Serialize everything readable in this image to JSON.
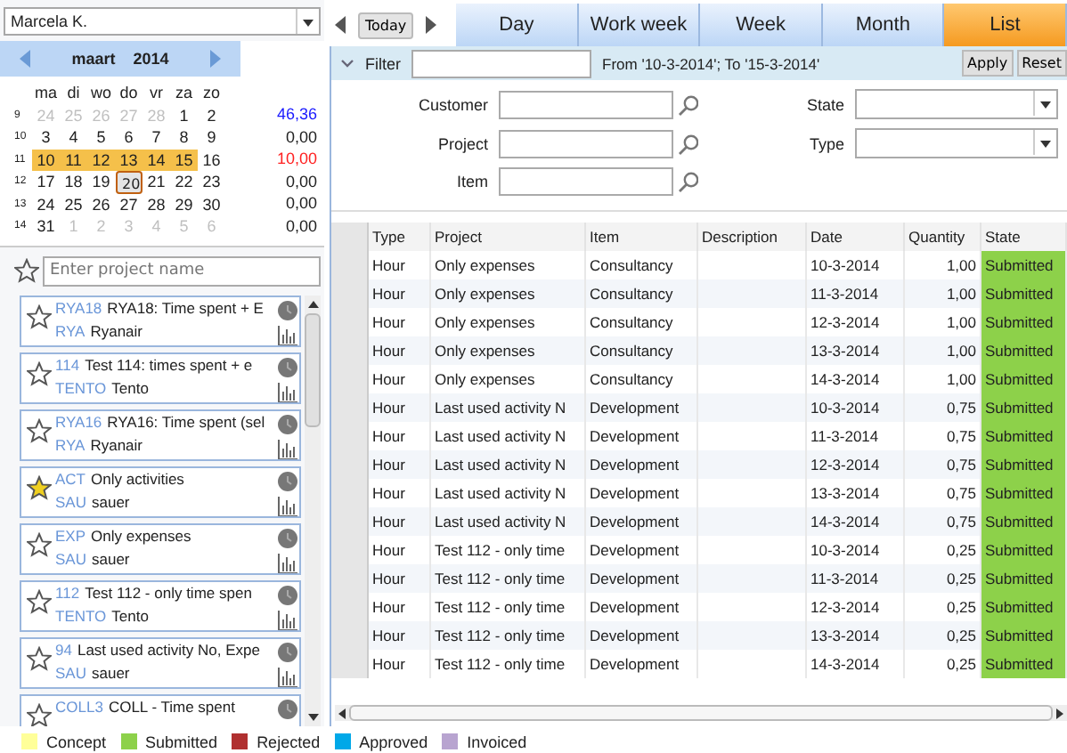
{
  "user_select": {
    "value": "Marcela K."
  },
  "calendar": {
    "month": "maart",
    "year": "2014",
    "weekdays": [
      "ma",
      "di",
      "wo",
      "do",
      "vr",
      "za",
      "zo"
    ],
    "weeks": [
      {
        "number": "9",
        "total": "46,36",
        "color": "#1a1aff",
        "days": [
          {
            "label": "24",
            "other_month": true,
            "selected": false,
            "today": false
          },
          {
            "label": "25",
            "other_month": true,
            "selected": false,
            "today": false
          },
          {
            "label": "26",
            "other_month": true,
            "selected": false,
            "today": false
          },
          {
            "label": "27",
            "other_month": true,
            "selected": false,
            "today": false
          },
          {
            "label": "28",
            "other_month": true,
            "selected": false,
            "today": false
          },
          {
            "label": "1",
            "other_month": false,
            "selected": false,
            "today": false
          },
          {
            "label": "2",
            "other_month": false,
            "selected": false,
            "today": false
          }
        ]
      },
      {
        "number": "10",
        "total": "0,00",
        "color": "#222222",
        "days": [
          {
            "label": "3",
            "other_month": false,
            "selected": false,
            "today": false
          },
          {
            "label": "4",
            "other_month": false,
            "selected": false,
            "today": false
          },
          {
            "label": "5",
            "other_month": false,
            "selected": false,
            "today": false
          },
          {
            "label": "6",
            "other_month": false,
            "selected": false,
            "today": false
          },
          {
            "label": "7",
            "other_month": false,
            "selected": false,
            "today": false
          },
          {
            "label": "8",
            "other_month": false,
            "selected": false,
            "today": false
          },
          {
            "label": "9",
            "other_month": false,
            "selected": false,
            "today": false
          }
        ]
      },
      {
        "number": "11",
        "total": "10,00",
        "color": "#ff2020",
        "days": [
          {
            "label": "10",
            "other_month": false,
            "selected": true,
            "today": false
          },
          {
            "label": "11",
            "other_month": false,
            "selected": true,
            "today": false
          },
          {
            "label": "12",
            "other_month": false,
            "selected": true,
            "today": false
          },
          {
            "label": "13",
            "other_month": false,
            "selected": true,
            "today": false
          },
          {
            "label": "14",
            "other_month": false,
            "selected": true,
            "today": false
          },
          {
            "label": "15",
            "other_month": false,
            "selected": true,
            "today": false
          },
          {
            "label": "16",
            "other_month": false,
            "selected": false,
            "today": false
          }
        ]
      },
      {
        "number": "12",
        "total": "0,00",
        "color": "#222222",
        "days": [
          {
            "label": "17",
            "other_month": false,
            "selected": false,
            "today": false
          },
          {
            "label": "18",
            "other_month": false,
            "selected": false,
            "today": false
          },
          {
            "label": "19",
            "other_month": false,
            "selected": false,
            "today": false
          },
          {
            "label": "20",
            "other_month": false,
            "selected": false,
            "today": true
          },
          {
            "label": "21",
            "other_month": false,
            "selected": false,
            "today": false
          },
          {
            "label": "22",
            "other_month": false,
            "selected": false,
            "today": false
          },
          {
            "label": "23",
            "other_month": false,
            "selected": false,
            "today": false
          }
        ]
      },
      {
        "number": "13",
        "total": "0,00",
        "color": "#222222",
        "days": [
          {
            "label": "24",
            "other_month": false,
            "selected": false,
            "today": false
          },
          {
            "label": "25",
            "other_month": false,
            "selected": false,
            "today": false
          },
          {
            "label": "26",
            "other_month": false,
            "selected": false,
            "today": false
          },
          {
            "label": "27",
            "other_month": false,
            "selected": false,
            "today": false
          },
          {
            "label": "28",
            "other_month": false,
            "selected": false,
            "today": false
          },
          {
            "label": "29",
            "other_month": false,
            "selected": false,
            "today": false
          },
          {
            "label": "30",
            "other_month": false,
            "selected": false,
            "today": false
          }
        ]
      },
      {
        "number": "14",
        "total": "0,00",
        "color": "#222222",
        "days": [
          {
            "label": "31",
            "other_month": false,
            "selected": false,
            "today": false
          },
          {
            "label": "1",
            "other_month": true,
            "selected": false,
            "today": false
          },
          {
            "label": "2",
            "other_month": true,
            "selected": false,
            "today": false
          },
          {
            "label": "3",
            "other_month": true,
            "selected": false,
            "today": false
          },
          {
            "label": "4",
            "other_month": true,
            "selected": false,
            "today": false
          },
          {
            "label": "5",
            "other_month": true,
            "selected": false,
            "today": false
          },
          {
            "label": "6",
            "other_month": true,
            "selected": false,
            "today": false
          }
        ]
      }
    ]
  },
  "project_search": {
    "placeholder": "Enter project name"
  },
  "projects": [
    {
      "code": "RYA18",
      "name": "RYA18: Time spent + E",
      "customer_code": "RYA",
      "customer": "Ryanair",
      "favorite": false
    },
    {
      "code": "114",
      "name": "Test 114: times spent + e",
      "customer_code": "TENTO",
      "customer": "Tento",
      "favorite": false
    },
    {
      "code": "RYA16",
      "name": "RYA16: Time spent (sel",
      "customer_code": "RYA",
      "customer": "Ryanair",
      "favorite": false
    },
    {
      "code": "ACT",
      "name": "Only activities",
      "customer_code": "SAU",
      "customer": "sauer",
      "favorite": true
    },
    {
      "code": "EXP",
      "name": "Only expenses",
      "customer_code": "SAU",
      "customer": "sauer",
      "favorite": false
    },
    {
      "code": "112",
      "name": "Test 112 - only time spen",
      "customer_code": "TENTO",
      "customer": "Tento",
      "favorite": false
    },
    {
      "code": "94",
      "name": "Last used activity No, Expe",
      "customer_code": "SAU",
      "customer": "sauer",
      "favorite": false
    },
    {
      "code": "COLL3",
      "name": "COLL - Time spent",
      "favorite": false
    }
  ],
  "legend": [
    {
      "label": "Concept",
      "color": "#ffff99"
    },
    {
      "label": "Submitted",
      "color": "#8dd14a"
    },
    {
      "label": "Rejected",
      "color": "#b03030"
    },
    {
      "label": "Approved",
      "color": "#00a8e8"
    },
    {
      "label": "Invoiced",
      "color": "#b8a4d0"
    }
  ],
  "nav": {
    "today": "Today"
  },
  "tabs": [
    {
      "label": "Day",
      "selected": false
    },
    {
      "label": "Work week",
      "selected": false
    },
    {
      "label": "Week",
      "selected": false
    },
    {
      "label": "Month",
      "selected": false
    },
    {
      "label": "List",
      "selected": true
    }
  ],
  "filter": {
    "label": "Filter",
    "range": "From '10-3-2014'; To '15-3-2014'",
    "buttons": [
      "Apply",
      "Reset"
    ],
    "fields": [
      {
        "label": "Customer",
        "kind": "lookup"
      },
      {
        "label": "State",
        "kind": "select"
      },
      {
        "label": "Project",
        "kind": "lookup"
      },
      {
        "label": "Type",
        "kind": "select"
      },
      {
        "label": "Item",
        "kind": "lookup"
      }
    ]
  },
  "table": {
    "columns": [
      "Type",
      "Project",
      "Item",
      "Description",
      "Date",
      "Quantity",
      "State"
    ],
    "rows": [
      {
        "cells": [
          "Hour",
          "Only expenses",
          "Consultancy",
          "",
          "10-3-2014",
          "1,00",
          "Submitted"
        ],
        "color": "#8dd14a"
      },
      {
        "cells": [
          "Hour",
          "Only expenses",
          "Consultancy",
          "",
          "11-3-2014",
          "1,00",
          "Submitted"
        ],
        "color": "#8dd14a"
      },
      {
        "cells": [
          "Hour",
          "Only expenses",
          "Consultancy",
          "",
          "12-3-2014",
          "1,00",
          "Submitted"
        ],
        "color": "#8dd14a"
      },
      {
        "cells": [
          "Hour",
          "Only expenses",
          "Consultancy",
          "",
          "13-3-2014",
          "1,00",
          "Submitted"
        ],
        "color": "#8dd14a"
      },
      {
        "cells": [
          "Hour",
          "Only expenses",
          "Consultancy",
          "",
          "14-3-2014",
          "1,00",
          "Submitted"
        ],
        "color": "#8dd14a"
      },
      {
        "cells": [
          "Hour",
          "Last used activity N",
          "Development",
          "",
          "10-3-2014",
          "0,75",
          "Submitted"
        ],
        "color": "#8dd14a"
      },
      {
        "cells": [
          "Hour",
          "Last used activity N",
          "Development",
          "",
          "11-3-2014",
          "0,75",
          "Submitted"
        ],
        "color": "#8dd14a"
      },
      {
        "cells": [
          "Hour",
          "Last used activity N",
          "Development",
          "",
          "12-3-2014",
          "0,75",
          "Submitted"
        ],
        "color": "#8dd14a"
      },
      {
        "cells": [
          "Hour",
          "Last used activity N",
          "Development",
          "",
          "13-3-2014",
          "0,75",
          "Submitted"
        ],
        "color": "#8dd14a"
      },
      {
        "cells": [
          "Hour",
          "Last used activity N",
          "Development",
          "",
          "14-3-2014",
          "0,75",
          "Submitted"
        ],
        "color": "#8dd14a"
      },
      {
        "cells": [
          "Hour",
          "Test 112 - only time",
          "Development",
          "",
          "10-3-2014",
          "0,25",
          "Submitted"
        ],
        "color": "#8dd14a"
      },
      {
        "cells": [
          "Hour",
          "Test 112 - only time",
          "Development",
          "",
          "11-3-2014",
          "0,25",
          "Submitted"
        ],
        "color": "#8dd14a"
      },
      {
        "cells": [
          "Hour",
          "Test 112 - only time",
          "Development",
          "",
          "12-3-2014",
          "0,25",
          "Submitted"
        ],
        "color": "#8dd14a"
      },
      {
        "cells": [
          "Hour",
          "Test 112 - only time",
          "Development",
          "",
          "13-3-2014",
          "0,25",
          "Submitted"
        ],
        "color": "#8dd14a"
      },
      {
        "cells": [
          "Hour",
          "Test 112 - only time",
          "Development",
          "",
          "14-3-2014",
          "0,25",
          "Submitted"
        ],
        "color": "#8dd14a"
      }
    ]
  }
}
